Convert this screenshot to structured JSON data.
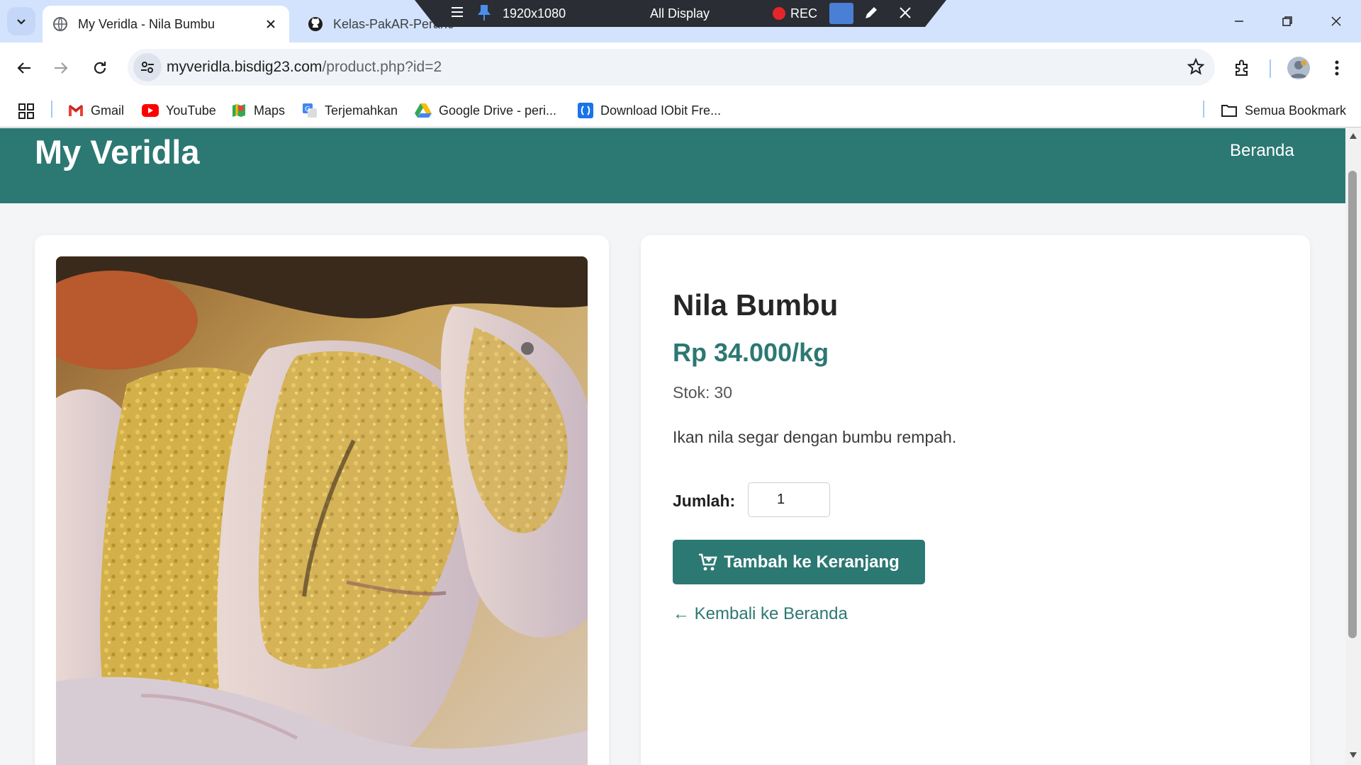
{
  "browser": {
    "active_tab": {
      "title": "My Veridla - Nila Bumbu"
    },
    "inactive_tab": {
      "title": "Kelas-PakAR-Peranc..."
    },
    "url": {
      "domain": "myveridla.bisdig23.com",
      "path": "/product.php?id=2"
    },
    "bookmarks": [
      {
        "label": "Gmail",
        "icon": "gmail-icon"
      },
      {
        "label": "YouTube",
        "icon": "youtube-icon"
      },
      {
        "label": "Maps",
        "icon": "maps-icon"
      },
      {
        "label": "Terjemahkan",
        "icon": "translate-icon"
      },
      {
        "label": "Google Drive - peri...",
        "icon": "drive-icon"
      },
      {
        "label": "Download IObit Fre...",
        "icon": "iobit-icon"
      }
    ],
    "all_bookmarks_label": "Semua Bookmark"
  },
  "recorder": {
    "resolution": "1920x1080",
    "display": "All Display",
    "rec_label": "REC"
  },
  "site": {
    "brand": "My Veridla",
    "nav": {
      "home": "Beranda"
    }
  },
  "product": {
    "name": "Nila Bumbu",
    "price": "Rp 34.000/kg",
    "stock_label": "Stok:",
    "stock_value": "30",
    "description": "Ikan nila segar dengan bumbu rempah.",
    "quantity_label": "Jumlah:",
    "quantity_value": "1",
    "add_to_cart_label": "Tambah ke Keranjang",
    "back_label": "← Kembali ke Beranda"
  },
  "colors": {
    "brand": "#2c7873",
    "tabstrip": "#d3e3fd",
    "page_bg": "#f4f5f7"
  }
}
